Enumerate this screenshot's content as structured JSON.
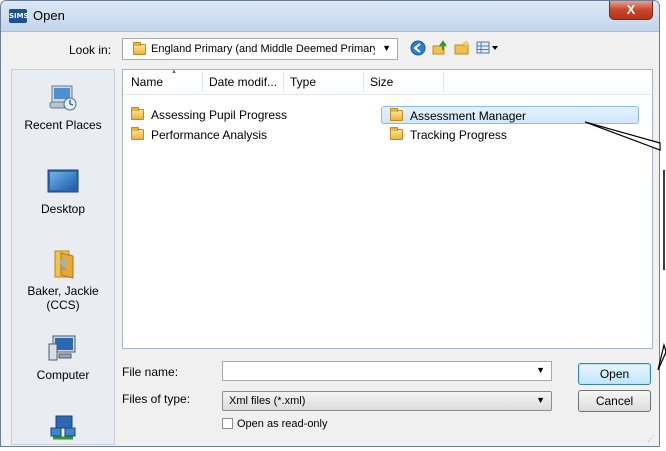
{
  "window": {
    "title": "Open",
    "app_icon_text": "SIMS",
    "close_label": "X"
  },
  "look_in": {
    "label": "Look in:",
    "value": "England Primary (and Middle Deemed Primary)"
  },
  "toolbar": {
    "icons": [
      "back-icon",
      "up-folder-icon",
      "new-folder-icon",
      "views-icon"
    ]
  },
  "places": [
    {
      "label": "Recent Places",
      "icon": "recent-places-icon"
    },
    {
      "label": "Desktop",
      "icon": "desktop-icon"
    },
    {
      "label": "Baker, Jackie (CCS)",
      "icon": "user-folder-icon"
    },
    {
      "label": "Computer",
      "icon": "computer-icon"
    },
    {
      "label": "",
      "icon": "network-icon"
    }
  ],
  "file_list": {
    "columns": [
      "Name",
      "Date modif...",
      "Type",
      "Size"
    ],
    "items": [
      {
        "name": "Assessing Pupil Progress",
        "selected": false
      },
      {
        "name": "Performance Analysis",
        "selected": false
      },
      {
        "name": "Assessment Manager",
        "selected": true
      },
      {
        "name": "Tracking Progress",
        "selected": false
      }
    ]
  },
  "file_name": {
    "label": "File name:",
    "value": ""
  },
  "file_type": {
    "label": "Files of type:",
    "value": "Xml files (*.xml)"
  },
  "read_only": {
    "label": "Open as read-only",
    "checked": false
  },
  "buttons": {
    "open": "Open",
    "cancel": "Cancel"
  }
}
